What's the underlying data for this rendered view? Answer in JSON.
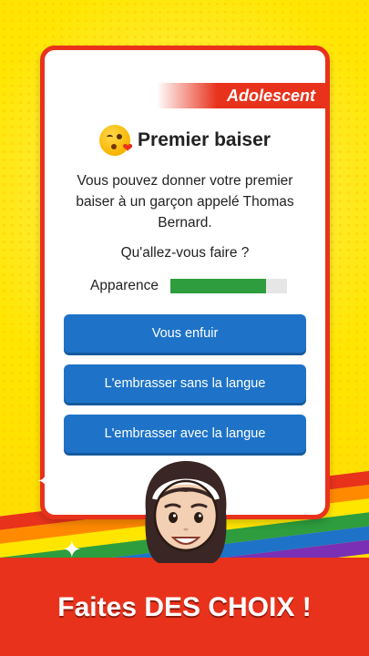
{
  "stage": {
    "label": "Adolescent"
  },
  "event": {
    "title": "Premier baiser",
    "emoji_icon": "kissing-face-icon",
    "description": "Vous pouvez donner votre premier baiser à un garçon appelé Thomas Bernard.",
    "question": "Qu'allez-vous faire ?"
  },
  "stat": {
    "label": "Apparence",
    "value": 0.82,
    "color": "#2e9d3e"
  },
  "choices": [
    {
      "label": "Vous enfuir"
    },
    {
      "label": "L'embrasser sans la langue"
    },
    {
      "label": "L'embrasser avec la langue"
    }
  ],
  "promo": {
    "slogan": "Faites DES CHOIX !"
  },
  "colors": {
    "accent_red": "#e8321c",
    "button_blue": "#1e73c8",
    "background_yellow": "#ffe600",
    "rainbow": [
      "#e8321c",
      "#ff8a00",
      "#ffe600",
      "#2e9d3e",
      "#1e73c8",
      "#7a2fb5"
    ]
  }
}
